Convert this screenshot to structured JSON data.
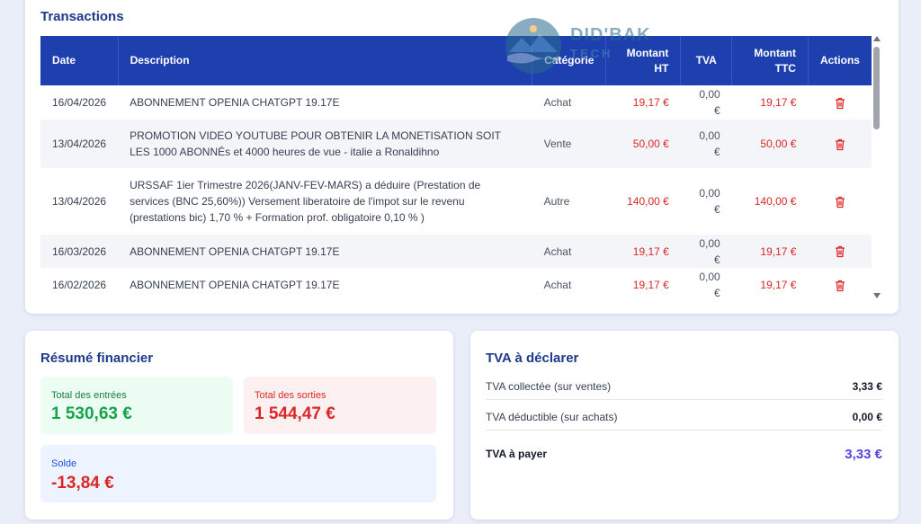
{
  "transactions": {
    "title": "Transactions",
    "columns": {
      "date": "Date",
      "description": "Description",
      "category": "Catégorie",
      "amount_ht": "Montant HT",
      "vat": "TVA",
      "amount_ttc": "Montant TTC",
      "actions": "Actions"
    },
    "rows": [
      {
        "date": "16/04/2026",
        "description": "ABONNEMENT OPENIA CHATGPT 19.17E",
        "category": "Achat",
        "amount_ht": "19,17 €",
        "vat": "0,00 €",
        "amount_ttc": "19,17 €"
      },
      {
        "date": "13/04/2026",
        "description": "PROMOTION VIDEO YOUTUBE POUR OBTENIR LA MONETISATION SOIT LES 1000 ABONNÉs et 4000 heures de vue - italie a Ronaldihno",
        "category": "Vente",
        "amount_ht": "50,00 €",
        "vat": "0,00 €",
        "amount_ttc": "50,00 €"
      },
      {
        "date": "13/04/2026",
        "description": "URSSAF 1ier Trimestre 2026(JANV-FEV-MARS) a déduire (Prestation de services (BNC 25,60%)) Versement liberatoire de l'impot sur le revenu (prestations bic) 1,70 % + Formation prof. obligatoire 0,10 % )",
        "category": "Autre",
        "amount_ht": "140,00 €",
        "vat": "0,00 €",
        "amount_ttc": "140,00 €"
      },
      {
        "date": "16/03/2026",
        "description": "ABONNEMENT OPENIA CHATGPT 19.17E",
        "category": "Achat",
        "amount_ht": "19,17 €",
        "vat": "0,00 €",
        "amount_ttc": "19,17 €"
      },
      {
        "date": "16/02/2026",
        "description": "ABONNEMENT OPENIA CHATGPT 19.17E",
        "category": "Achat",
        "amount_ht": "19,17 €",
        "vat": "0,00 €",
        "amount_ttc": "19,17 €"
      }
    ]
  },
  "watermark": {
    "line1": "DID'BAK",
    "line2": "TECH"
  },
  "summary": {
    "title": "Résumé financier",
    "income_label": "Total des entrées",
    "income_value": "1 530,63 €",
    "expenses_label": "Total des sorties",
    "expenses_value": "1 544,47 €",
    "balance_label": "Solde",
    "balance_value": "-13,84 €"
  },
  "vat": {
    "title": "TVA à déclarer",
    "collected_label": "TVA collectée (sur ventes)",
    "collected_value": "3,33 €",
    "deductible_label": "TVA déductible (sur achats)",
    "deductible_value": "0,00 €",
    "payable_label": "TVA à payer",
    "payable_value": "3,33 €"
  },
  "colors": {
    "header_blue": "#1e40af",
    "title_blue": "#1e3a8a",
    "negative_red": "#dc2626",
    "positive_green": "#16a34a",
    "payable_indigo": "#4f46e5"
  },
  "icons": {
    "row_action": "trash-icon"
  }
}
